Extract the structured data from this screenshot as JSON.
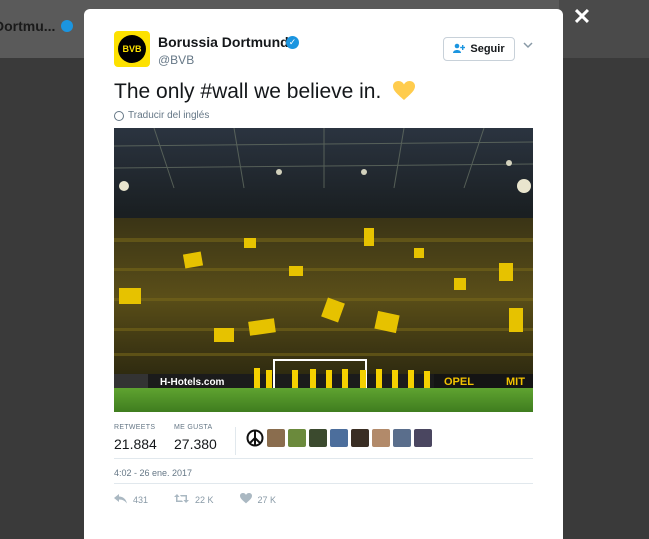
{
  "background": {
    "profile_name": "Dortmu..."
  },
  "modal": {
    "close_label": "✕"
  },
  "author": {
    "name": "Borussia Dortmund",
    "handle": "@BVB",
    "avatar_text": "BVB"
  },
  "follow": {
    "label": "Seguir"
  },
  "tweet": {
    "text_before": "The only ",
    "hashtag": "#wall",
    "text_after": " we believe in.",
    "translate_label": "Traducir del inglés"
  },
  "photo": {
    "ads": [
      "H-Hotels.com",
      "OPEL",
      "MIT"
    ]
  },
  "stats": {
    "retweets_label": "RETWEETS",
    "retweets_value": "21.884",
    "likes_label": "ME GUSTA",
    "likes_value": "27.380"
  },
  "likers": [
    {
      "name": "peace-avatar"
    },
    {
      "name": "user-avatar-2"
    },
    {
      "name": "user-avatar-3"
    },
    {
      "name": "user-avatar-4"
    },
    {
      "name": "user-avatar-5"
    },
    {
      "name": "user-avatar-6"
    },
    {
      "name": "user-avatar-7"
    },
    {
      "name": "user-avatar-8"
    },
    {
      "name": "user-avatar-9"
    }
  ],
  "timestamp": "4:02 - 26 ene. 2017",
  "actions": {
    "reply_count": "431",
    "retweet_count": "22 K",
    "like_count": "27 K"
  },
  "colors": {
    "brand_yellow": "#fde100",
    "link_blue": "#1b95e0",
    "text_dark": "#14171a",
    "text_muted": "#657786"
  }
}
